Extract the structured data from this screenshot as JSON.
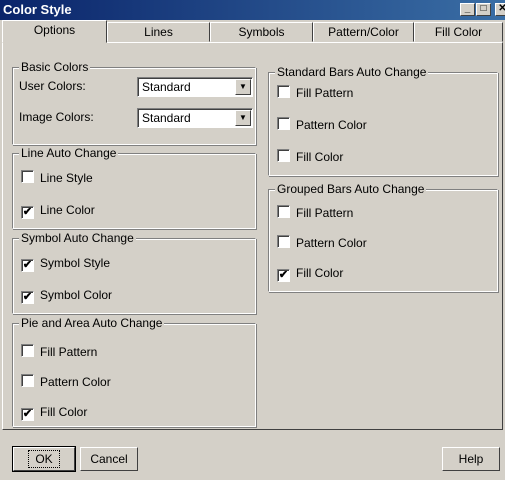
{
  "window": {
    "title": "Color Style"
  },
  "tabs": [
    {
      "label": "Options",
      "active": true
    },
    {
      "label": "Lines"
    },
    {
      "label": "Symbols"
    },
    {
      "label": "Pattern/Color"
    },
    {
      "label": "Fill Color"
    }
  ],
  "basic_colors": {
    "legend": "Basic Colors",
    "user_colors_label": "User Colors:",
    "user_colors_value": "Standard",
    "image_colors_label": "Image Colors:",
    "image_colors_value": "Standard"
  },
  "line_auto_change": {
    "legend": "Line Auto Change",
    "items": [
      {
        "label": "Line Style",
        "checked": false
      },
      {
        "label": "Line Color",
        "checked": true
      }
    ]
  },
  "symbol_auto_change": {
    "legend": "Symbol Auto Change",
    "items": [
      {
        "label": "Symbol Style",
        "checked": true
      },
      {
        "label": "Symbol Color",
        "checked": true
      }
    ]
  },
  "pie_area_auto_change": {
    "legend": "Pie and Area Auto Change",
    "items": [
      {
        "label": "Fill Pattern",
        "checked": false
      },
      {
        "label": "Pattern Color",
        "checked": false
      },
      {
        "label": "Fill Color",
        "checked": true
      }
    ]
  },
  "standard_bars_auto_change": {
    "legend": "Standard Bars Auto Change",
    "items": [
      {
        "label": "Fill Pattern",
        "checked": false
      },
      {
        "label": "Pattern Color",
        "checked": false
      },
      {
        "label": "Fill Color",
        "checked": false
      }
    ]
  },
  "grouped_bars_auto_change": {
    "legend": "Grouped Bars Auto Change",
    "items": [
      {
        "label": "Fill Pattern",
        "checked": false
      },
      {
        "label": "Pattern Color",
        "checked": false
      },
      {
        "label": "Fill Color",
        "checked": true
      }
    ]
  },
  "buttons": {
    "ok": "OK",
    "cancel": "Cancel",
    "help": "Help"
  },
  "check_glyph": "✔",
  "title_buttons": {
    "minimize": "_",
    "maximize": "□",
    "close": "✕"
  }
}
